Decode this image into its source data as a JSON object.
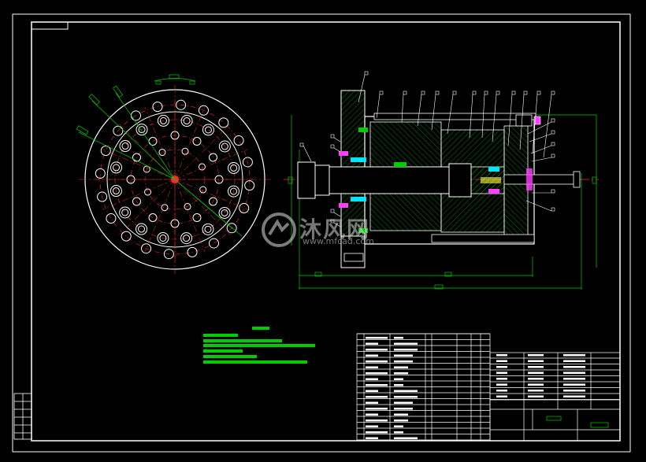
{
  "watermark": {
    "brand": "沐风网",
    "url": "www.mfcad.com"
  },
  "colors": {
    "background": "#000000",
    "frame": "#ffffff",
    "center_line": "#ff2a2a",
    "dimension": "#00cc00",
    "part": "#ffffff",
    "hatch": "#00b000",
    "accent_magenta": "#ff40ff",
    "accent_cyan": "#00e5ff",
    "accent_yellow": "#ffff40"
  }
}
